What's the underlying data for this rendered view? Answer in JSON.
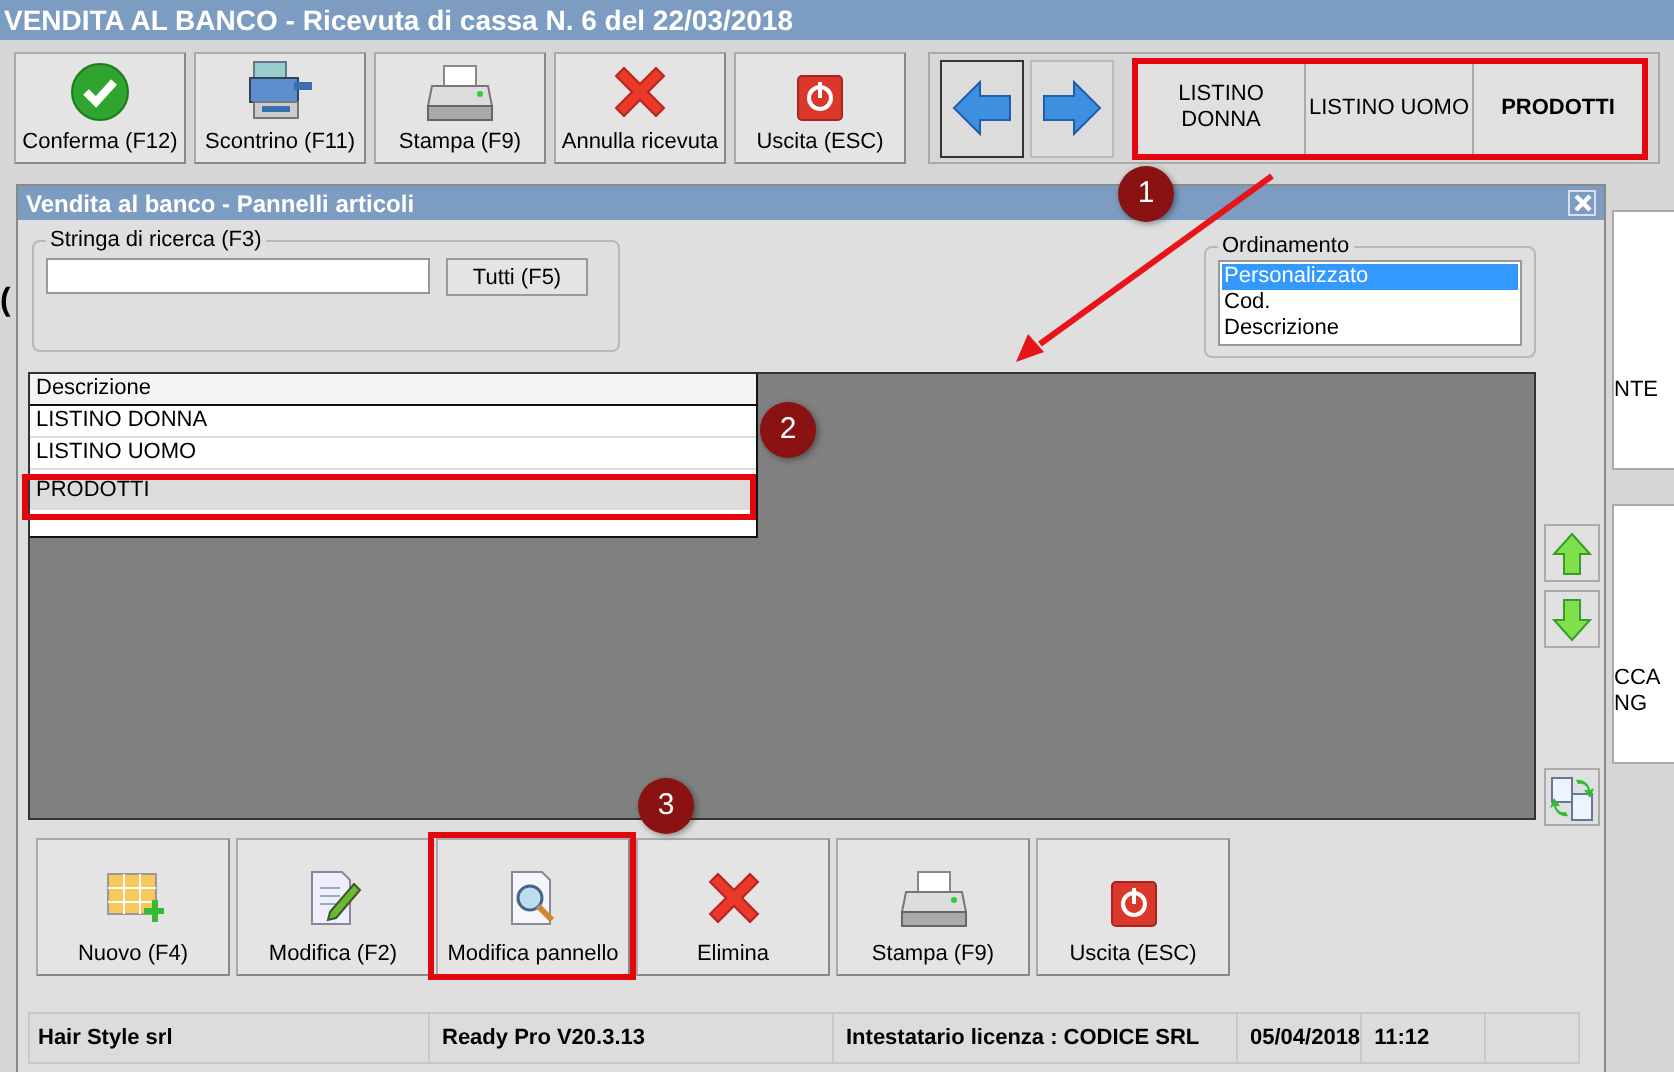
{
  "window": {
    "title": "VENDITA AL BANCO - Ricevuta di cassa N. 6 del 22/03/2018"
  },
  "toolbar": [
    {
      "label": "Conferma (F12)",
      "kind": "check"
    },
    {
      "label": "Scontrino (F11)",
      "kind": "register"
    },
    {
      "label": "Stampa (F9)",
      "kind": "printer"
    },
    {
      "label": "Annulla ricevuta",
      "kind": "cross"
    },
    {
      "label": "Uscita (ESC)",
      "kind": "power"
    }
  ],
  "panel_tabs": [
    {
      "label": "LISTINO\nDONNA",
      "selected": false
    },
    {
      "label": "LISTINO UOMO",
      "selected": false
    },
    {
      "label": "PRODOTTI",
      "selected": true
    }
  ],
  "background": {
    "left_fragment": "(",
    "cards": [
      {
        "lines": [
          "NTE"
        ]
      },
      {
        "lines": [
          "CCA",
          "NG"
        ]
      }
    ]
  },
  "dialog": {
    "title": "Vendita al banco - Pannelli articoli",
    "search": {
      "label": "Stringa di ricerca (F3)",
      "button": "Tutti (F5)"
    },
    "sort": {
      "label": "Ordinamento",
      "options": [
        {
          "label": "Personalizzato",
          "selected": true
        },
        {
          "label": "Cod.",
          "selected": false
        },
        {
          "label": "Descrizione",
          "selected": false
        }
      ]
    },
    "table": {
      "columns": [
        "Descrizione"
      ],
      "rows": [
        {
          "cells": [
            "LISTINO DONNA"
          ],
          "selected": false
        },
        {
          "cells": [
            "LISTINO UOMO"
          ],
          "selected": false
        },
        {
          "cells": [
            "PRODOTTI"
          ],
          "selected": true
        }
      ]
    },
    "buttons": [
      {
        "label": "Nuovo (F4)",
        "kind": "grid-add"
      },
      {
        "label": "Modifica (F2)",
        "kind": "edit"
      },
      {
        "label": "Modifica pannello",
        "kind": "inspect"
      },
      {
        "label": "Elimina",
        "kind": "cross"
      },
      {
        "label": "Stampa (F9)",
        "kind": "printer"
      },
      {
        "label": "Uscita (ESC)",
        "kind": "power"
      }
    ],
    "status_bar": [
      "Hair Style srl",
      "Ready Pro V20.3.13",
      "Intestatario licenza : CODICE SRL",
      "05/04/2018",
      "11:12"
    ]
  },
  "annotations": [
    "1",
    "2",
    "3"
  ]
}
